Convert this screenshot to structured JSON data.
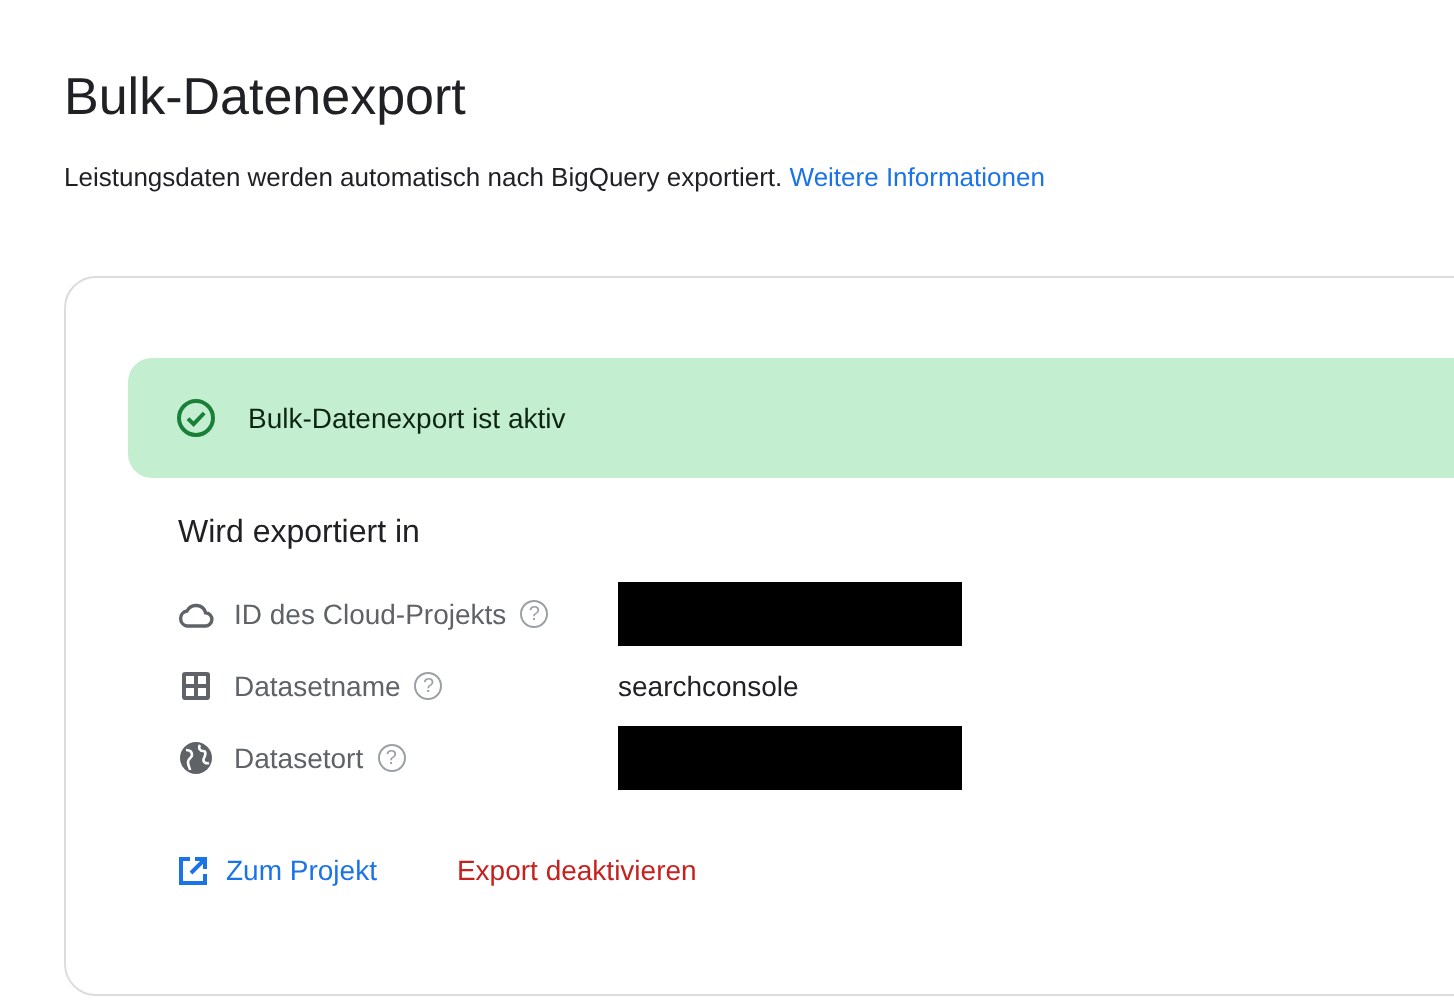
{
  "page": {
    "title": "Bulk-Datenexport",
    "description": "Leistungsdaten werden automatisch nach BigQuery exportiert.",
    "link": "Weitere Informationen"
  },
  "status": {
    "kind": "success",
    "text": "Bulk-Datenexport ist aktiv"
  },
  "section_title": "Wird exportiert in",
  "rows": [
    {
      "label": "ID des Cloud-Projekts",
      "help": "?",
      "redacted": true
    },
    {
      "label": "Datasetname",
      "help": "?",
      "redacted": false,
      "value": "searchconsole"
    },
    {
      "label": "Datasetort",
      "help": "?",
      "redacted": true
    }
  ],
  "actions": [
    {
      "kind": "link",
      "label": "Zum Projekt"
    },
    {
      "kind": "danger",
      "label": "Export deaktivieren"
    }
  ]
}
